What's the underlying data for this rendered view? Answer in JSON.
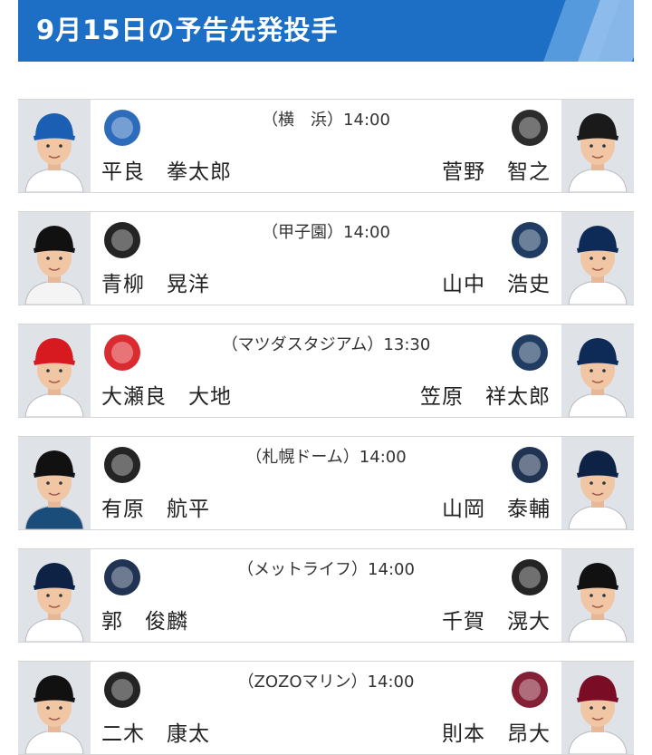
{
  "header": {
    "title": "9月15日の予告先発投手"
  },
  "games": [
    {
      "venue": "（横　浜）14:00",
      "home": {
        "pitcher": "平良　拳太郎",
        "logo": "baystars-logo",
        "cap_color": "#1a5fb4",
        "jersey_color": "#ffffff"
      },
      "away": {
        "pitcher": "菅野　智之",
        "logo": "giants-logo",
        "cap_color": "#1a1a1a",
        "jersey_color": "#ffffff"
      }
    },
    {
      "venue": "（甲子園）14:00",
      "home": {
        "pitcher": "青柳　晃洋",
        "logo": "tigers-logo",
        "cap_color": "#111111",
        "jersey_color": "#f4f4f4"
      },
      "away": {
        "pitcher": "山中　浩史",
        "logo": "swallows-logo",
        "cap_color": "#0d2b56",
        "jersey_color": "#ffffff"
      }
    },
    {
      "venue": "（マツダスタジアム）13:30",
      "home": {
        "pitcher": "大瀬良　大地",
        "logo": "carp-logo",
        "cap_color": "#d71920",
        "jersey_color": "#ffffff"
      },
      "away": {
        "pitcher": "笠原　祥太郎",
        "logo": "dragons-logo",
        "cap_color": "#0d2b56",
        "jersey_color": "#ffffff"
      }
    },
    {
      "venue": "（札幌ドーム）14:00",
      "home": {
        "pitcher": "有原　航平",
        "logo": "fighters-logo",
        "cap_color": "#111111",
        "jersey_color": "#1a4d7a"
      },
      "away": {
        "pitcher": "山岡　泰輔",
        "logo": "buffaloes-logo",
        "cap_color": "#0d2244",
        "jersey_color": "#ffffff"
      }
    },
    {
      "venue": "（メットライフ）14:00",
      "home": {
        "pitcher": "郭　俊麟",
        "logo": "lions-logo",
        "cap_color": "#0d2244",
        "jersey_color": "#ffffff"
      },
      "away": {
        "pitcher": "千賀　滉大",
        "logo": "hawks-logo",
        "cap_color": "#111111",
        "jersey_color": "#ffffff"
      }
    },
    {
      "venue": "（ZOZOマリン）14:00",
      "home": {
        "pitcher": "二木　康太",
        "logo": "marines-logo",
        "cap_color": "#111111",
        "jersey_color": "#ffffff"
      },
      "away": {
        "pitcher": "則本　昂大",
        "logo": "eagles-logo",
        "cap_color": "#7a0c25",
        "jersey_color": "#ffffff"
      }
    }
  ],
  "colors": {
    "header_bg": "#1c6fc5",
    "card_border": "#d5d5d5",
    "text": "#222222"
  }
}
